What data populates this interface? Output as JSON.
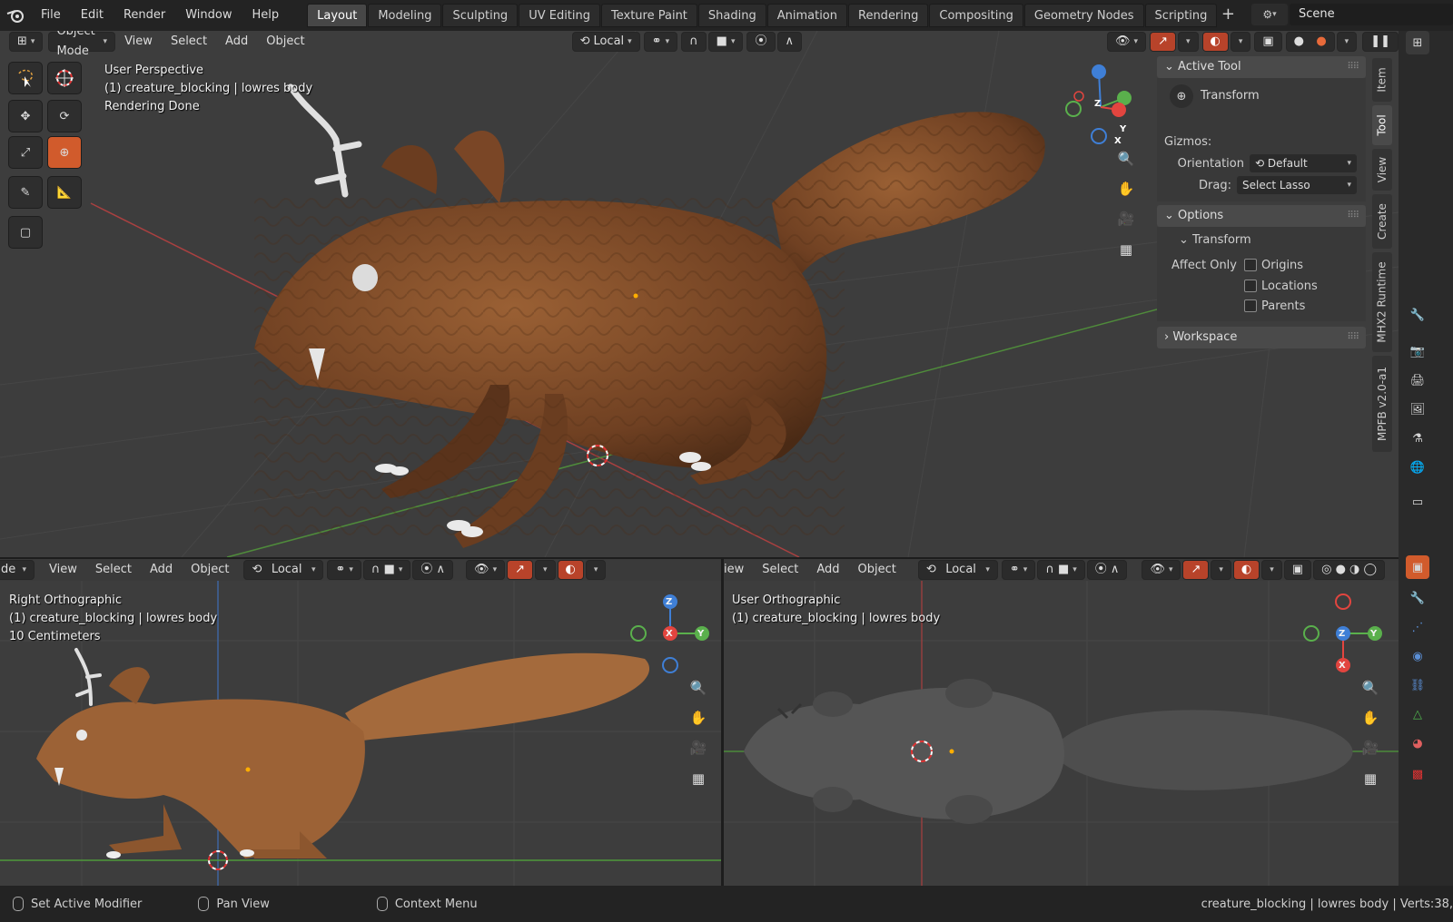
{
  "topbar": {
    "menus": [
      "File",
      "Edit",
      "Render",
      "Window",
      "Help"
    ],
    "workspaces": [
      "Layout",
      "Modeling",
      "Sculpting",
      "UV Editing",
      "Texture Paint",
      "Shading",
      "Animation",
      "Rendering",
      "Compositing",
      "Geometry Nodes",
      "Scripting"
    ],
    "active_workspace": "Layout",
    "add_label": "+",
    "scene": "Scene"
  },
  "main_viewport": {
    "mode": "Object Mode",
    "menus": [
      "View",
      "Select",
      "Add",
      "Object"
    ],
    "orientation": "Local",
    "info": [
      "User Perspective",
      "(1) creature_blocking | lowres body",
      "Rendering Done"
    ]
  },
  "npanel": {
    "active_tool_title": "Active Tool",
    "tool_name": "Transform",
    "gizmos_label": "Gizmos:",
    "orientation_label": "Orientation",
    "orientation_value": "Default",
    "drag_label": "Drag:",
    "drag_value": "Select Lasso",
    "options_title": "Options",
    "transform_title": "Transform",
    "affect_only_label": "Affect Only",
    "checkboxes": [
      "Origins",
      "Locations",
      "Parents"
    ],
    "workspace_title": "Workspace",
    "vertical_tabs": [
      "Item",
      "Tool",
      "View",
      "Create",
      "MHX2 Runtime",
      "MPFB v2.0-a1"
    ]
  },
  "left_viewport": {
    "mode_fragment": "de",
    "menus": [
      "View",
      "Select",
      "Add",
      "Object"
    ],
    "orientation": "Local",
    "info": [
      "Right Orthographic",
      "(1) creature_blocking | lowres body",
      "10 Centimeters"
    ]
  },
  "right_viewport": {
    "menus": [
      "View",
      "Select",
      "Add",
      "Object"
    ],
    "view_fragment": "iew",
    "orientation": "Local",
    "info": [
      "User Orthographic",
      "(1) creature_blocking | lowres body"
    ]
  },
  "axes": {
    "x": "X",
    "y": "Y",
    "z": "Z"
  },
  "statusbar": {
    "left": "Set Active Modifier",
    "middle": "Pan View",
    "right_action": "Context Menu",
    "stats": "creature_blocking | lowres body | Verts:38,"
  },
  "colors": {
    "accent": "#d15b2c",
    "creature_brown": "#7a4a2a",
    "axis_x": "#e2453f",
    "axis_y": "#5ab04c",
    "axis_z": "#3f7fd6"
  }
}
